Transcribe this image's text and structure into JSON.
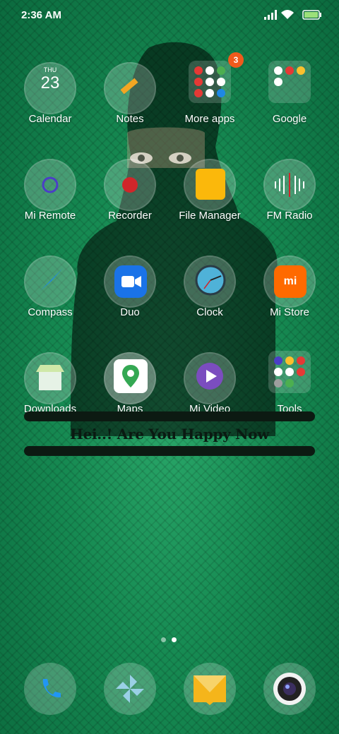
{
  "status_bar": {
    "time": "2:36 AM"
  },
  "apps": [
    {
      "label": "Calendar",
      "day": "THU",
      "date": "23"
    },
    {
      "label": "Notes"
    },
    {
      "label": "More apps",
      "badge": "3"
    },
    {
      "label": "Google"
    },
    {
      "label": "Mi Remote"
    },
    {
      "label": "Recorder"
    },
    {
      "label": "File Manager"
    },
    {
      "label": "FM Radio"
    },
    {
      "label": "Compass"
    },
    {
      "label": "Duo"
    },
    {
      "label": "Clock"
    },
    {
      "label": "Mi Store",
      "icon_text": "mi"
    },
    {
      "label": "Downloads"
    },
    {
      "label": "Maps"
    },
    {
      "label": "Mi Video"
    },
    {
      "label": "Tools"
    }
  ],
  "banner_text": "Hei..! Are You Happy Now",
  "pager": {
    "pages": 2,
    "current": 2
  },
  "dock": [
    "phone-icon",
    "gallery-icon",
    "messages-icon",
    "camera-icon"
  ],
  "colors": {
    "accent_orange": "#f05a1c",
    "wallpaper_green": "#168a52"
  }
}
